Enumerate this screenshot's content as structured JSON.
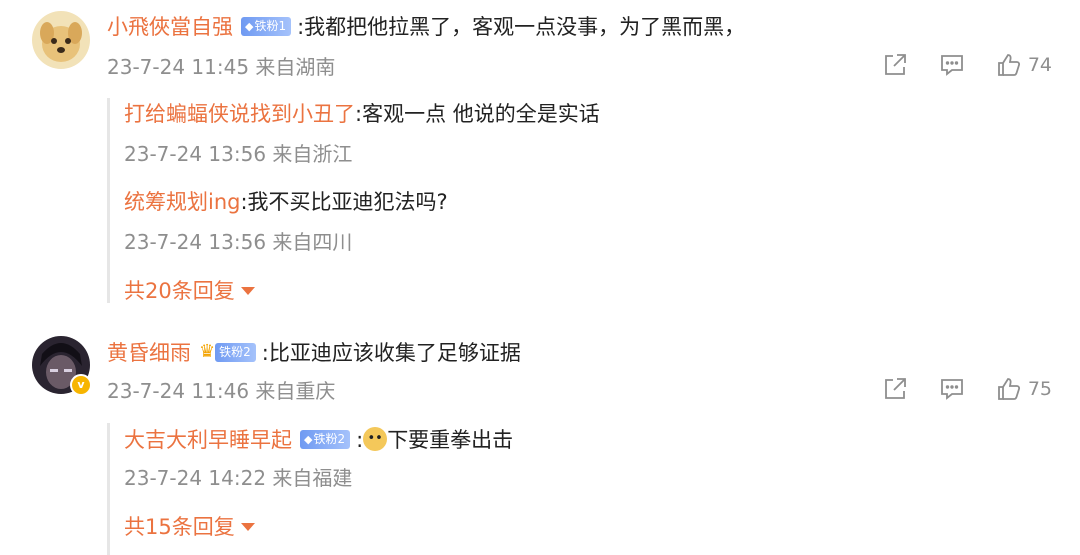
{
  "comments": [
    {
      "user": "小飛俠當自强",
      "badge": "铁粉1",
      "text": ":我都把他拉黑了，客观一点没事，为了黑而黑，",
      "time": "23-7-24 11:45 来自湖南",
      "likes": "74",
      "replies": [
        {
          "user": "打给蝙蝠侠说找到小丑了",
          "text": ":客观一点 他说的全是实话",
          "time": "23-7-24 13:56 来自浙江"
        },
        {
          "user": "统筹规划ing",
          "text": ":我不买比亚迪犯法吗?",
          "time": "23-7-24 13:56 来自四川"
        }
      ],
      "more_replies": "共20条回复"
    },
    {
      "user": "黄昏细雨",
      "badge": "铁粉2",
      "text": ":比亚迪应该收集了足够证据",
      "time": "23-7-24 11:46 来自重庆",
      "likes": "75",
      "replies": [
        {
          "user": "大吉大利早睡早起",
          "badge": "铁粉2",
          "text": "下要重拳出击",
          "prefix": ":",
          "time": "23-7-24 14:22 来自福建"
        }
      ],
      "more_replies": "共15条回复"
    }
  ],
  "colors": {
    "username": "#eb7340",
    "meta": "#8e8e8e",
    "badge": "#6f9af2"
  },
  "icons": {
    "share": "share-icon",
    "comment": "comment-icon",
    "like": "thumbs-up-icon",
    "verified": "verified-icon",
    "crown": "crown-icon",
    "emoji": "doge-emoji-icon"
  }
}
